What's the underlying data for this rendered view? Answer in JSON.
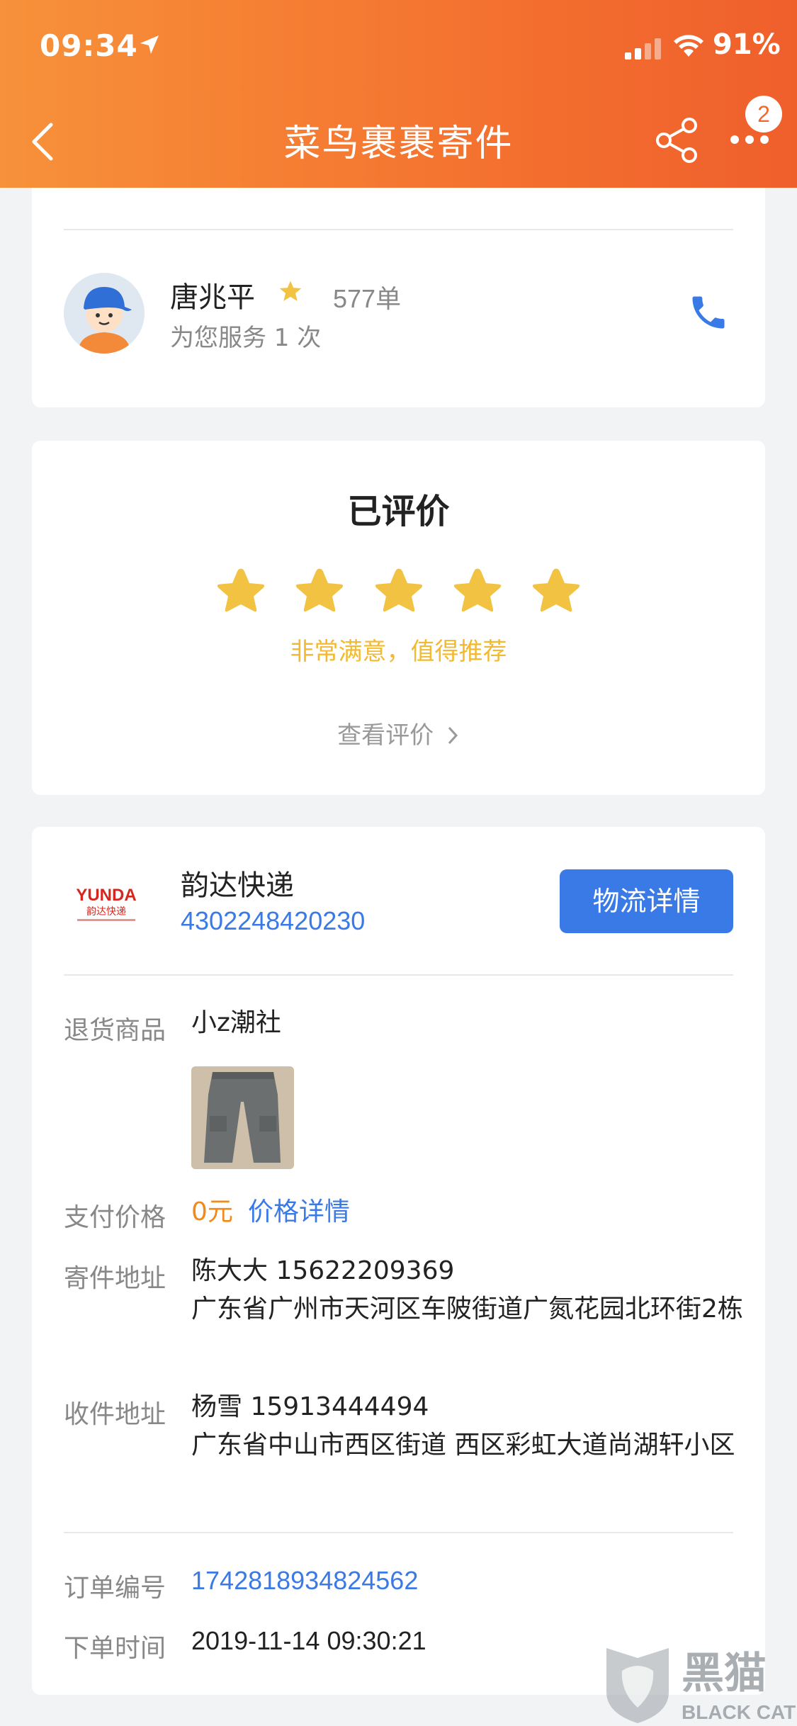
{
  "status_bar": {
    "time": "09:34",
    "battery": "91%"
  },
  "nav": {
    "title": "菜鸟裹裹寄件",
    "badge": "2"
  },
  "courier": {
    "name": "唐兆平",
    "orders": "577单",
    "served": "为您服务 1 次"
  },
  "rating": {
    "title": "已评价",
    "stars": 5,
    "description": "非常满意，值得推荐",
    "view_label": "查看评价"
  },
  "shipment": {
    "carrier_name": "韵达快递",
    "tracking_number": "4302248420230",
    "logistics_button": "物流详情",
    "logo_text": "YUNDA",
    "logo_subtext": "韵达快递",
    "fields": {
      "goods_label": "退货商品",
      "goods_value": "小z潮社",
      "price_label": "支付价格",
      "price_value": "0元",
      "price_link": "价格详情",
      "sender_label": "寄件地址",
      "sender_contact": "陈大大 15622209369",
      "sender_address": "广东省广州市天河区车陂街道广氮花园北环街2栋",
      "receiver_label": "收件地址",
      "receiver_contact": "杨雪 15913444494",
      "receiver_address": "广东省中山市西区街道 西区彩虹大道尚湖轩小区",
      "order_label": "订单编号",
      "order_value": "1742818934824562",
      "time_label": "下单时间",
      "time_value": "2019-11-14 09:30:21"
    }
  },
  "watermark": {
    "text_cn": "黑猫",
    "text_en": "BLACK CAT"
  },
  "colors": {
    "header_start": "#f7913a",
    "header_end": "#ef5f2c",
    "link_blue": "#3a7ae6",
    "star_yellow": "#f2b931",
    "price_orange": "#f08a1c"
  }
}
